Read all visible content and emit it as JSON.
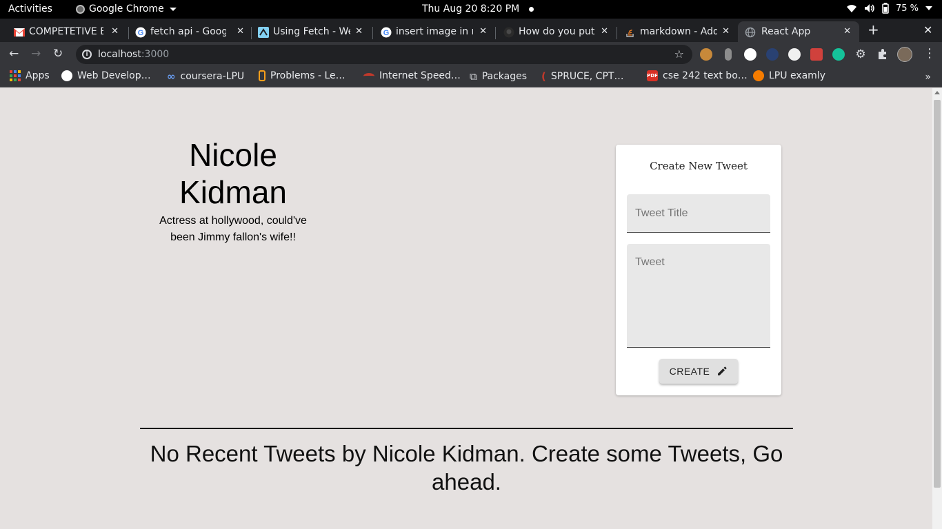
{
  "system_bar": {
    "activities": "Activities",
    "app_name": "Google Chrome",
    "clock": "Thu Aug 20  8:20 PM",
    "battery": "75 %"
  },
  "tabs": [
    {
      "title": "COMPETETIVE E",
      "icon": "gmail-icon",
      "active": false
    },
    {
      "title": "fetch api - Googl",
      "icon": "google-icon",
      "active": false
    },
    {
      "title": "Using Fetch - We",
      "icon": "mdn-icon",
      "active": false
    },
    {
      "title": "insert image in re",
      "icon": "google-icon",
      "active": false
    },
    {
      "title": "How do you put i",
      "icon": "github-icon",
      "active": false
    },
    {
      "title": "markdown - Add",
      "icon": "stackoverflow-icon",
      "active": false
    },
    {
      "title": "React App",
      "icon": "globe-icon",
      "active": true
    }
  ],
  "omnibox": {
    "host": "localhost",
    "port": ":3000"
  },
  "bookmarks": [
    {
      "label": "Apps",
      "icon": "apps-grid-icon"
    },
    {
      "label": "Web Develop…",
      "icon": "web-dev-icon"
    },
    {
      "label": "coursera-LPU",
      "icon": "coursera-icon"
    },
    {
      "label": "Problems - Le…",
      "icon": "leetcode-icon"
    },
    {
      "label": "Internet Speed…",
      "icon": "speedtest-icon"
    },
    {
      "label": "Packages",
      "icon": "external-link-icon"
    },
    {
      "label": "SPRUCE, CPT…",
      "icon": "spruce-icon"
    },
    {
      "label": "cse 242 text bo…",
      "icon": "pdf-icon"
    },
    {
      "label": "LPU examly",
      "icon": "examly-icon"
    }
  ],
  "profile": {
    "name": "Nicole Kidman",
    "bio": "Actress at hollywood, could've been Jimmy fallon's wife!!"
  },
  "tweet_form": {
    "heading": "Create New Tweet",
    "title_placeholder": "Tweet Title",
    "body_placeholder": "Tweet",
    "create_label": "CREATE"
  },
  "feed": {
    "empty_message": "No Recent Tweets by Nicole Kidman. Create some Tweets, Go ahead."
  },
  "colors": {
    "page_background": "#e5e1e0",
    "tab_strip": "#1f2023",
    "toolbar": "#35363a"
  }
}
